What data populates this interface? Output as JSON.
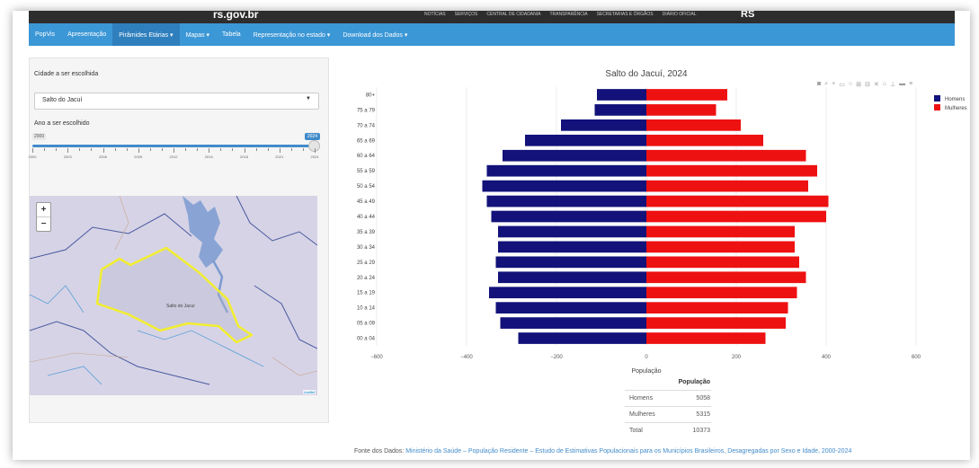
{
  "topbar": {
    "brand": "rs.gov.br",
    "links": [
      "NOTÍCIAS",
      "SERVIÇOS",
      "CENTRAL DE CIDADANIA",
      "TRANSPARÊNCIA",
      "SECRETARIAS E ÓRGÃOS",
      "DIÁRIO OFICIAL"
    ],
    "logo": "RS"
  },
  "nav": {
    "items": [
      {
        "label": "PopVis"
      },
      {
        "label": "Apresentação"
      },
      {
        "label": "Pirâmides Etárias ▾",
        "active": true
      },
      {
        "label": "Mapas ▾"
      },
      {
        "label": "Tabela"
      },
      {
        "label": "Representação no estado ▾"
      },
      {
        "label": "Download dos Dados ▾"
      }
    ]
  },
  "sidebar": {
    "city_label": "Cidade a ser escolhida",
    "city_value": "Salto do Jacuí",
    "year_label": "Ano a ser escolhido",
    "slider": {
      "min_label": "2000",
      "max_label": "2024",
      "value": 2024,
      "min": 2000,
      "max": 2024,
      "ticks": [
        "2000",
        "2003",
        "2006",
        "2009",
        "2012",
        "2015",
        "2018",
        "2021",
        "2024"
      ]
    }
  },
  "map": {
    "zoom_in": "+",
    "zoom_out": "−",
    "place_label": "Salto do Jacuí",
    "attribution": "Leaflet"
  },
  "modebar": {
    "icons": [
      "camera-icon",
      "zoom-icon",
      "plus-icon",
      "box-select-icon",
      "lasso-icon",
      "zoom-in-icon",
      "zoom-out-icon",
      "autoscale-icon",
      "home-icon",
      "spike-icon",
      "hover-icon",
      "compare-icon"
    ]
  },
  "chart_data": {
    "type": "bar",
    "orientation": "horizontal",
    "title": "Salto do Jacuí, 2024",
    "xlabel": "População",
    "ylabel": "",
    "xlim": [
      -600,
      600
    ],
    "xticks": [
      "−600",
      "−400",
      "−200",
      "0",
      "200",
      "400",
      "600"
    ],
    "categories": [
      "00 a 04",
      "05 a 09",
      "10 a 14",
      "15 a 19",
      "20 a 24",
      "25 a 29",
      "30 a 34",
      "35 a 39",
      "40 a 44",
      "45 a 49",
      "50 a 54",
      "55 a 59",
      "60 a 64",
      "65 a 69",
      "70 a 74",
      "75 a 79",
      "80+"
    ],
    "series": [
      {
        "name": "Homens",
        "color": "#12127a",
        "values": [
          -285,
          -325,
          -335,
          -350,
          -330,
          -335,
          -330,
          -330,
          -345,
          -355,
          -365,
          -355,
          -320,
          -270,
          -190,
          -115,
          -110
        ]
      },
      {
        "name": "Mulheres",
        "color": "#ee1111",
        "values": [
          265,
          310,
          315,
          335,
          355,
          340,
          330,
          330,
          400,
          405,
          360,
          380,
          355,
          260,
          210,
          155,
          180
        ]
      }
    ],
    "legend": "top-right",
    "grid": true
  },
  "table": {
    "header": "População",
    "rows": [
      {
        "label": "Homens",
        "value": "5058"
      },
      {
        "label": "Mulheres",
        "value": "5315"
      },
      {
        "label": "Total",
        "value": "10373"
      }
    ]
  },
  "source": {
    "prefix": "Fonte dos Dados:",
    "link": "Ministério da Saúde – População Residente – Estudo de Estimativas Populacionais para os Municípios Brasileiros, Desagregadas por Sexo e Idade, 2000-2024"
  }
}
